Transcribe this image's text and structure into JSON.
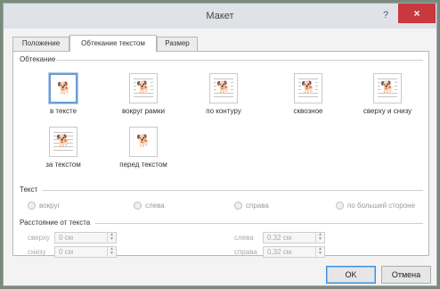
{
  "window": {
    "title": "Макет",
    "help": "?",
    "close": "×"
  },
  "tabs": [
    {
      "label": "Положение"
    },
    {
      "label": "Обтекание текстом"
    },
    {
      "label": "Размер"
    }
  ],
  "wrapping": {
    "section": "Обтекание",
    "options": [
      {
        "label": "в тексте",
        "icon": "wrap-inline-icon"
      },
      {
        "label": "вокруг рамки",
        "icon": "wrap-square-icon"
      },
      {
        "label": "по контуру",
        "icon": "wrap-tight-icon"
      },
      {
        "label": "сквозное",
        "icon": "wrap-through-icon"
      },
      {
        "label": "сверху и снизу",
        "icon": "wrap-top-bottom-icon"
      },
      {
        "label": "за текстом",
        "icon": "wrap-behind-icon"
      },
      {
        "label": "перед текстом",
        "icon": "wrap-front-icon"
      }
    ],
    "selected": "в тексте"
  },
  "text": {
    "section": "Текст",
    "options": [
      {
        "label": "вокруг"
      },
      {
        "label": "слева"
      },
      {
        "label": "справа"
      },
      {
        "label": "по большей стороне"
      }
    ]
  },
  "distance": {
    "section": "Расстояние от текста",
    "fields": [
      {
        "label": "сверху",
        "value": "0 см"
      },
      {
        "label": "снизу",
        "value": "0 см"
      },
      {
        "label": "слева",
        "value": "0,32 см"
      },
      {
        "label": "справа",
        "value": "0,32 см"
      }
    ]
  },
  "buttons": {
    "ok": "OK",
    "cancel": "Отмена"
  }
}
